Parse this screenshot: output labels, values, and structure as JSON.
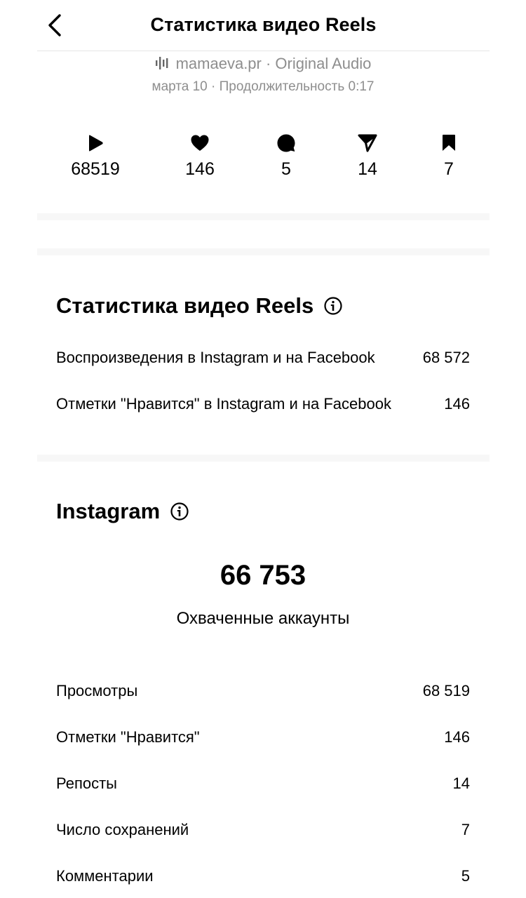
{
  "header": {
    "title": "Статистика видео Reels"
  },
  "audio": {
    "text": "mamaeva.pr · Original Audio",
    "meta": "марта 10 · Продолжительность 0:17"
  },
  "stats": {
    "plays": "68519",
    "likes": "146",
    "comments": "5",
    "shares": "14",
    "saves": "7"
  },
  "reels_section": {
    "title": "Статистика видео Reels",
    "rows": [
      {
        "label": "Воспроизведения в Instagram и на Facebook",
        "value": "68 572"
      },
      {
        "label": "Отметки \"Нравится\" в Instagram и на Facebook",
        "value": "146"
      }
    ]
  },
  "instagram_section": {
    "title": "Instagram",
    "reach_value": "66 753",
    "reach_label": "Охваченные аккаунты",
    "rows": [
      {
        "label": "Просмотры",
        "value": "68 519"
      },
      {
        "label": "Отметки \"Нравится\"",
        "value": "146"
      },
      {
        "label": "Репосты",
        "value": "14"
      },
      {
        "label": "Число сохранений",
        "value": "7"
      },
      {
        "label": "Комментарии",
        "value": "5"
      }
    ]
  },
  "colors": {
    "secondary_text": "#8e8e8e",
    "separator": "#f7f7f7",
    "text": "#000000"
  },
  "icons": [
    "chevron-left-icon",
    "audio-wave-icon",
    "play-icon",
    "heart-icon",
    "comment-icon",
    "send-icon",
    "bookmark-icon",
    "info-icon"
  ]
}
